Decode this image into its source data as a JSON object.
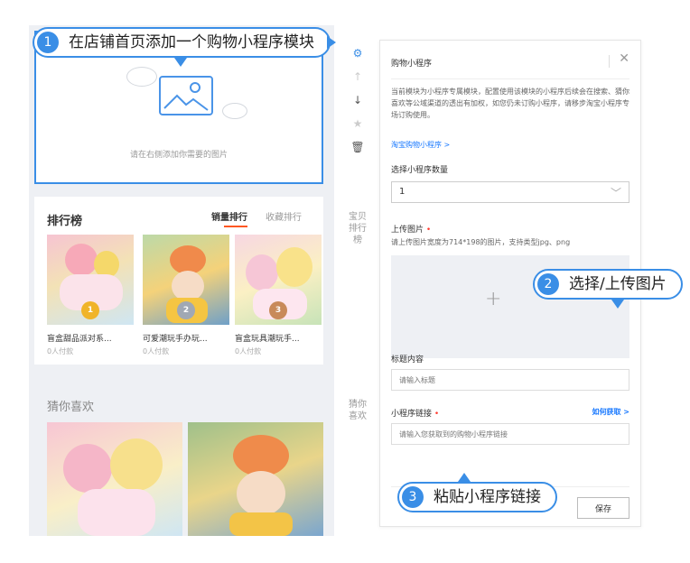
{
  "colors": {
    "accent": "#3a8ee6",
    "link": "#1677ff",
    "orange": "#ff5722",
    "required": "#ff3b30"
  },
  "banner": {
    "hint": "请在右侧添加你需要的图片"
  },
  "ranking": {
    "title": "排行榜",
    "tabs": [
      {
        "label": "销量排行",
        "active": true
      },
      {
        "label": "收藏排行",
        "active": false
      }
    ],
    "products": [
      {
        "name": "盲盒甜品派对系...",
        "sales": "0人付款",
        "medal": "1",
        "medal_color": "#f0b429"
      },
      {
        "name": "可爱潮玩手办玩...",
        "sales": "0人付款",
        "medal": "2",
        "medal_color": "#a0a8b4"
      },
      {
        "name": "盲盒玩具潮玩手...",
        "sales": "0人付款",
        "medal": "3",
        "medal_color": "#c88a5a"
      }
    ]
  },
  "guess": {
    "title": "猜你喜欢"
  },
  "toolbar": {
    "icons": [
      "gear-icon",
      "arrow-up-icon",
      "arrow-down-icon",
      "star-icon",
      "trash-icon"
    ],
    "rank_label": "宝贝排行榜",
    "guess_label": "猜你喜欢"
  },
  "panel": {
    "title": "购物小程序",
    "description": "当前模块为小程序专属模块，配置使用该模块的小程序后续会在搜索、猜你喜欢等公域渠道的透出有加权，如您仍未订购小程序，请移步淘宝小程序专场订购使用。",
    "shop_link": "淘宝购物小程序 >",
    "count_label": "选择小程序数量",
    "count_value": "1",
    "upload_label": "上传图片",
    "upload_hint": "请上传图片宽度为714*198的图片，支持类型jpg、png",
    "title_label": "标题内容",
    "title_placeholder": "请输入标题",
    "link_label": "小程序链接",
    "how_link": "如何获取 >",
    "link_placeholder": "请输入您获取到的购物小程序链接",
    "save": "保存"
  },
  "callouts": [
    {
      "num": "1",
      "text": "在店铺首页添加一个购物小程序模块"
    },
    {
      "num": "2",
      "text": "选择/上传图片"
    },
    {
      "num": "3",
      "text": "粘贴小程序链接"
    }
  ]
}
